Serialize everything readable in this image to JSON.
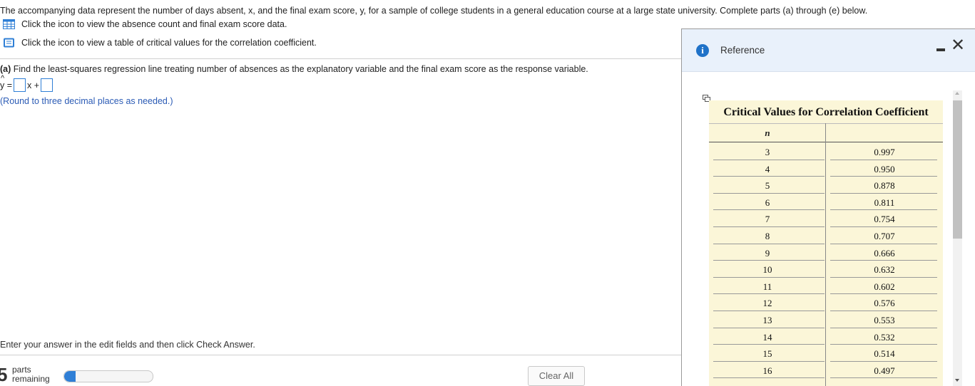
{
  "question": {
    "intro": "The accompanying data represent the number of days absent, x, and the final exam score, y, for a sample of college students in a general education course at a large state university. Complete parts (a) through (e) below.",
    "data_link": "Click the icon to view the absence count and final exam score data.",
    "table_link": "Click the icon to view a table of critical values for the correlation coefficient.",
    "part_a_label": "(a)",
    "part_a_text": "Find the least-squares regression line treating number of absences as the explanatory variable and the final exam score as the response variable.",
    "equation": {
      "lhs": "y",
      "hat": "^",
      "equals": "=",
      "x_plus": "x +"
    },
    "rounding_note": "(Round to three decimal places as needed.)"
  },
  "footer": {
    "instructions": "Enter your answer in the edit fields and then click Check Answer.",
    "parts_count": "5",
    "parts_label_1": "parts",
    "parts_label_2": "remaining",
    "progress_fraction": 0.13,
    "clear_all": "Clear All"
  },
  "reference_panel": {
    "title": "Reference",
    "table_title": "Critical Values for Correlation Coefficient",
    "column_header": "n",
    "rows": [
      {
        "n": "3",
        "r": "0.997"
      },
      {
        "n": "4",
        "r": "0.950"
      },
      {
        "n": "5",
        "r": "0.878"
      },
      {
        "n": "6",
        "r": "0.811"
      },
      {
        "n": "7",
        "r": "0.754"
      },
      {
        "n": "8",
        "r": "0.707"
      },
      {
        "n": "9",
        "r": "0.666"
      },
      {
        "n": "10",
        "r": "0.632"
      },
      {
        "n": "11",
        "r": "0.602"
      },
      {
        "n": "12",
        "r": "0.576"
      },
      {
        "n": "13",
        "r": "0.553"
      },
      {
        "n": "14",
        "r": "0.532"
      },
      {
        "n": "15",
        "r": "0.514"
      },
      {
        "n": "16",
        "r": "0.497"
      }
    ]
  },
  "colors": {
    "accent": "#2f7fd6",
    "panel_header": "#e9f1fb",
    "table_bg": "#fbf6d8",
    "note_text": "#2b5bb5"
  },
  "icons": {
    "data_icon": "table-grid-icon",
    "table_icon": "book-icon",
    "info": "info-icon",
    "minimize": "minimize-icon",
    "close": "close-icon",
    "copy": "copy-icon"
  }
}
